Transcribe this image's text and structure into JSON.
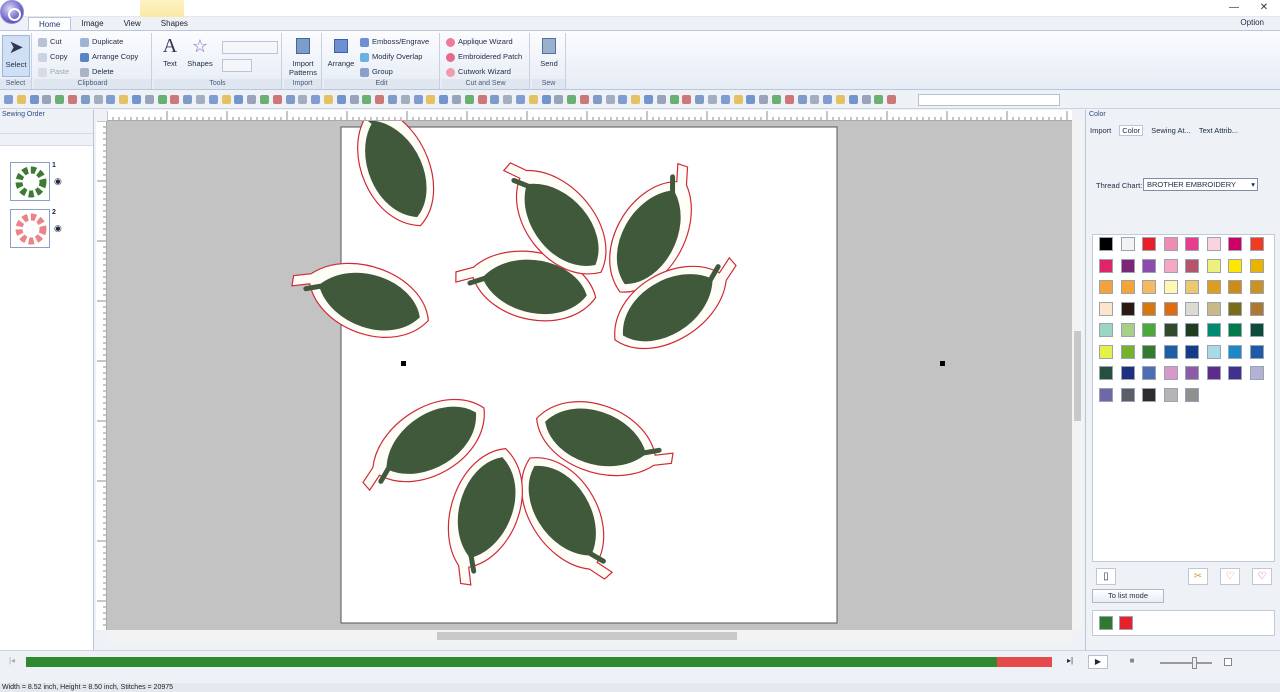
{
  "ribbon_tabs": [
    "Home",
    "Image",
    "View",
    "Shapes"
  ],
  "option_label": "Option",
  "window_buttons": [
    "—",
    "❐",
    "✕"
  ],
  "groups": {
    "select": {
      "label": "Select",
      "button": "Select"
    },
    "clipboard": {
      "label": "Clipboard",
      "cut": "Cut",
      "copy": "Copy",
      "paste": "Paste",
      "duplicate": "Duplicate",
      "arrange_copy": "Arrange Copy",
      "delete": "Delete"
    },
    "tools": {
      "label": "Tools",
      "text": "Text",
      "shapes": "Shapes"
    },
    "import": {
      "label": "Import",
      "button": "Import Patterns"
    },
    "edit": {
      "label": "Edit",
      "arrange": "Arrange",
      "emboss": "Emboss/Engrave",
      "modify": "Modify Overlap",
      "group": "Group"
    },
    "cutsew": {
      "label": "Cut and Sew",
      "applique": "Applique Wizard",
      "patch": "Embroidered Patch",
      "cutwork": "Cutwork Wizard"
    },
    "sew": {
      "label": "Sew",
      "button": "Send"
    }
  },
  "left_panel": {
    "title": "Sewing Order",
    "items": [
      "1",
      "2"
    ]
  },
  "color_panel": {
    "title": "Color",
    "tabs": [
      "Import",
      "Color",
      "Sewing At...",
      "Text Attrib..."
    ],
    "thread_chart_label": "Thread Chart:",
    "thread_chart_value": "BROTHER EMBROIDERY",
    "list_mode_label": "To list mode",
    "palette": [
      "#000000",
      "#f3f3f3",
      "#e8202a",
      "#f08cb2",
      "#e63e8c",
      "#f9d3de",
      "#cc0066",
      "#ef3b24",
      "#e0246a",
      "#7b2677",
      "#8b4caa",
      "#f5a7c3",
      "#b5546a",
      "#eff07a",
      "#ffe600",
      "#e8b400",
      "#f4a23b",
      "#f5a535",
      "#f5b95e",
      "#fff7b2",
      "#eac96d",
      "#dd9d1f",
      "#cf8b16",
      "#c99225",
      "#fde5cc",
      "#2c1a12",
      "#d8780c",
      "#e06b10",
      "#dcdad1",
      "#c9b98a",
      "#7a6d1a",
      "#ac7832",
      "#9bd6c3",
      "#a7cf86",
      "#4aa938",
      "#314a2b",
      "#1e3d1e",
      "#008a6f",
      "#007a4b",
      "#0e4b38",
      "#e5f14b",
      "#77b32d",
      "#357a2e",
      "#1b5fa5",
      "#163b88",
      "#a8dbe3",
      "#1d88c5",
      "#1e5aa8",
      "#264f40",
      "#1d2f7e",
      "#4d6db5",
      "#d79ac8",
      "#8d5ca8",
      "#5d2a8d",
      "#42308f",
      "#b3b2d4",
      "#6e67a8",
      "#5b5f65",
      "#2d2d2d",
      "#b5b5b5",
      "#8f8f8f"
    ],
    "used_colors": [
      "#2f7a2f",
      "#e8202a"
    ]
  },
  "progress": {
    "value": 0.946,
    "sewn_color": "#2f8a2f",
    "remaining_color": "#e74a4a"
  },
  "status_text": "Width = 8.52 inch, Height = 8.50 inch, Stitches = 20975",
  "leaf_color": "#40593b",
  "outline_color": "#cf2a37"
}
